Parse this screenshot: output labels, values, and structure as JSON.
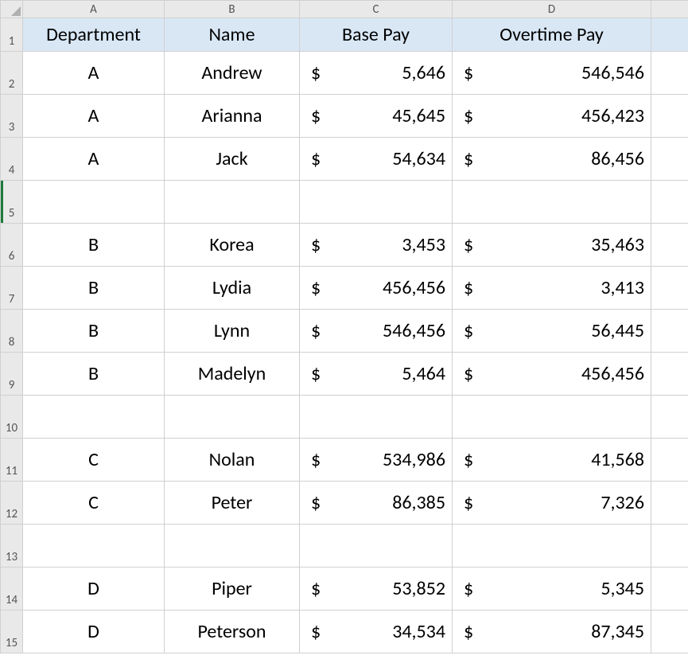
{
  "columns": [
    "A",
    "B",
    "C",
    "D"
  ],
  "row_numbers": [
    "1",
    "2",
    "3",
    "4",
    "5",
    "6",
    "7",
    "8",
    "9",
    "10",
    "11",
    "12",
    "13",
    "14",
    "15"
  ],
  "headers": {
    "dept": "Department",
    "name": "Name",
    "base": "Base Pay",
    "ot": "Overtime Pay"
  },
  "currency_symbol": "$",
  "selected_row_header": "5",
  "rows": [
    {
      "r": "2",
      "dept": "A",
      "name": "Andrew",
      "base": "5,646",
      "ot": "546,546"
    },
    {
      "r": "3",
      "dept": "A",
      "name": "Arianna",
      "base": "45,645",
      "ot": "456,423"
    },
    {
      "r": "4",
      "dept": "A",
      "name": "Jack",
      "base": "54,634",
      "ot": "86,456"
    },
    {
      "r": "5",
      "blank": true
    },
    {
      "r": "6",
      "dept": "B",
      "name": "Korea",
      "base": "3,453",
      "ot": "35,463"
    },
    {
      "r": "7",
      "dept": "B",
      "name": "Lydia",
      "base": "456,456",
      "ot": "3,413"
    },
    {
      "r": "8",
      "dept": "B",
      "name": "Lynn",
      "base": "546,456",
      "ot": "56,445"
    },
    {
      "r": "9",
      "dept": "B",
      "name": "Madelyn",
      "base": "5,464",
      "ot": "456,456"
    },
    {
      "r": "10",
      "blank": true
    },
    {
      "r": "11",
      "dept": "C",
      "name": "Nolan",
      "base": "534,986",
      "ot": "41,568"
    },
    {
      "r": "12",
      "dept": "C",
      "name": "Peter",
      "base": "86,385",
      "ot": "7,326"
    },
    {
      "r": "13",
      "blank": true
    },
    {
      "r": "14",
      "dept": "D",
      "name": "Piper",
      "base": "53,852",
      "ot": "5,345"
    },
    {
      "r": "15",
      "dept": "D",
      "name": "Peterson",
      "base": "34,534",
      "ot": "87,345"
    }
  ],
  "chart_data": {
    "type": "table",
    "columns": [
      "Department",
      "Name",
      "Base Pay",
      "Overtime Pay"
    ],
    "rows": [
      [
        "A",
        "Andrew",
        5646,
        546546
      ],
      [
        "A",
        "Arianna",
        45645,
        456423
      ],
      [
        "A",
        "Jack",
        54634,
        86456
      ],
      [
        "B",
        "Korea",
        3453,
        35463
      ],
      [
        "B",
        "Lydia",
        456456,
        3413
      ],
      [
        "B",
        "Lynn",
        546456,
        56445
      ],
      [
        "B",
        "Madelyn",
        5464,
        456456
      ],
      [
        "C",
        "Nolan",
        534986,
        41568
      ],
      [
        "C",
        "Peter",
        86385,
        7326
      ],
      [
        "D",
        "Piper",
        53852,
        5345
      ],
      [
        "D",
        "Peterson",
        34534,
        87345
      ]
    ]
  }
}
